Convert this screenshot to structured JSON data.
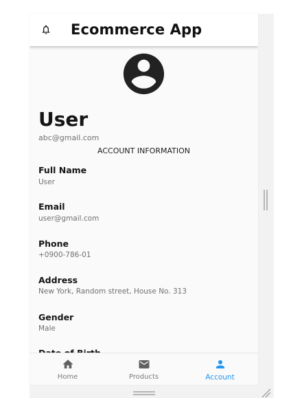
{
  "app": {
    "title": "Ecommerce App",
    "icons": {
      "notifications": "bell-icon"
    }
  },
  "profile": {
    "avatar_icon": "account-circle-icon",
    "name": "User",
    "email": "abc@gmail.com",
    "section_title": "ACCOUNT INFORMATION",
    "fields": [
      {
        "label": "Full Name",
        "value": "User"
      },
      {
        "label": "Email",
        "value": "user@gmail.com"
      },
      {
        "label": "Phone",
        "value": "+0900-786-01"
      },
      {
        "label": "Address",
        "value": "New York, Random street, House No. 313"
      },
      {
        "label": "Gender",
        "value": "Male"
      },
      {
        "label": "Date of Birth",
        "value": ""
      }
    ]
  },
  "bottom_nav": {
    "items": [
      {
        "label": "Home",
        "icon": "home-icon",
        "active": false
      },
      {
        "label": "Products",
        "icon": "mail-icon",
        "active": false
      },
      {
        "label": "Account",
        "icon": "person-icon",
        "active": true
      }
    ],
    "active_color": "#2196F3",
    "inactive_color": "#7A7A7A"
  }
}
